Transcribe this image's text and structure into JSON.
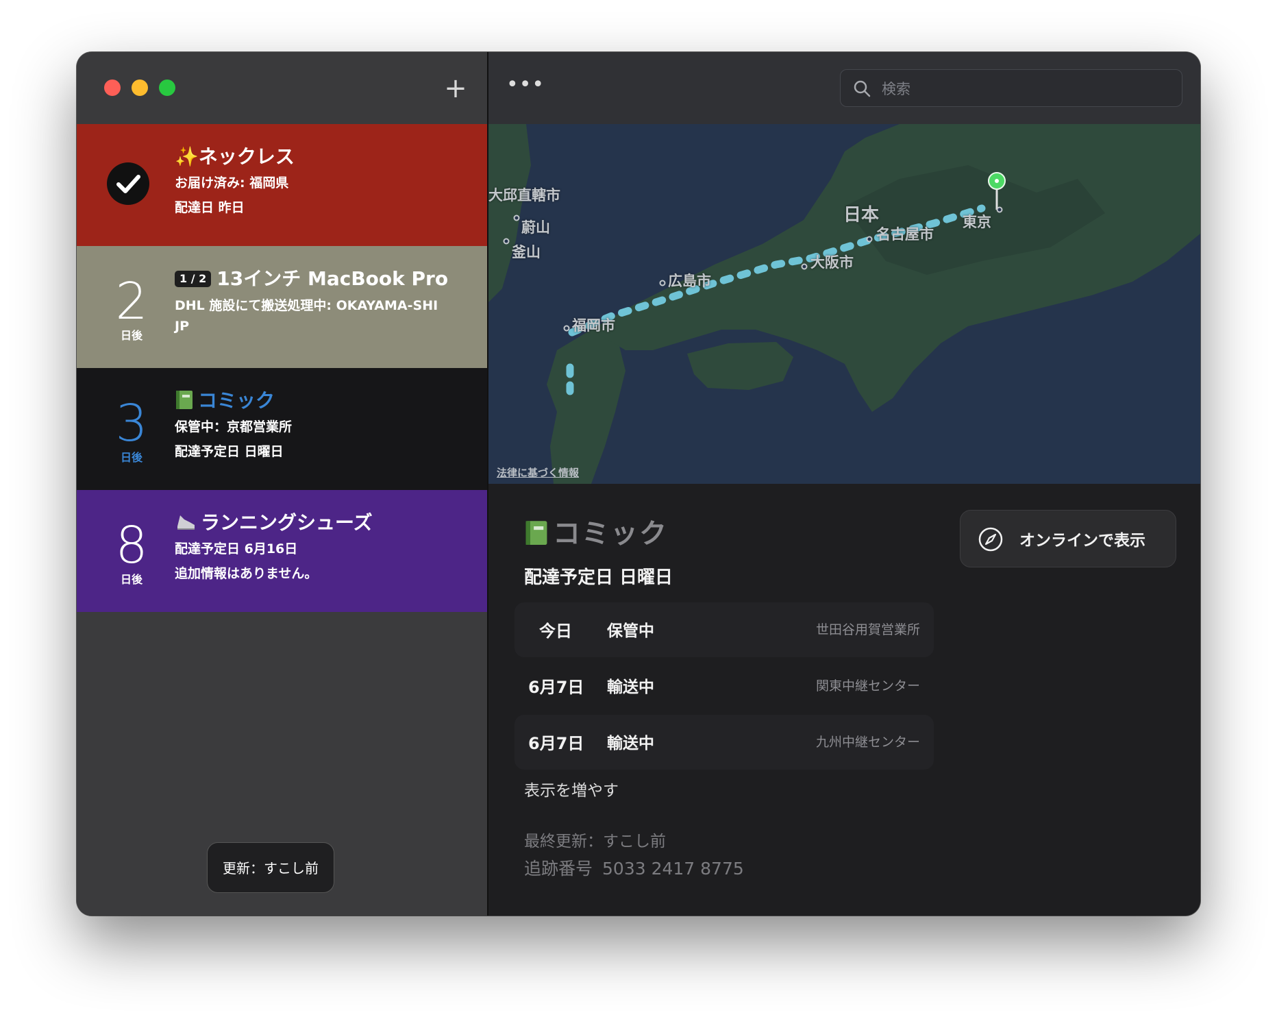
{
  "sidebar": {
    "add_label": "+",
    "items": [
      {
        "kind": "delivered",
        "title": "✨ネックレス",
        "line1": "お届け済み: 福岡県",
        "line2": "配達日 昨日",
        "bg": "#9d2419"
      },
      {
        "kind": "days",
        "days": "2",
        "unit": "日後",
        "part": "1 / 2",
        "title": "13インチ MacBook Pro",
        "line1": "DHL 施設にて搬送処理中: OKAYAMA-SHI",
        "line2": "JP",
        "bg": "#8d8c79"
      },
      {
        "kind": "days",
        "days": "3",
        "unit": "日後",
        "title": "コミック",
        "icon": "green-book-icon",
        "line1": "保管中：京都営業所",
        "line2": "配達予定日 日曜日",
        "bg": "#161618",
        "accent": "#3a86d6"
      },
      {
        "kind": "days",
        "days": "8",
        "unit": "日後",
        "title": "ランニングシューズ",
        "icon": "running-shoe-icon",
        "line1": "配達予定日 6月16日",
        "line2": "追加情報はありません。",
        "bg": "#4d2587"
      }
    ],
    "update_label": "更新：すこし前"
  },
  "toolbar": {
    "more_label": "•••",
    "search_placeholder": "検索"
  },
  "map": {
    "labels": {
      "daegu": "大邱直轄市",
      "ulsan": "蔚山",
      "busan": "釜山",
      "japan": "日本",
      "nagoya": "名古屋市",
      "tokyo": "東京",
      "osaka": "大阪市",
      "hiroshima": "広島市",
      "fukuoka": "福岡市"
    },
    "legal": "法律に基づく情報",
    "route_color": "#6fc3d6",
    "pin_color": "#4cd964"
  },
  "detail": {
    "title": "コミック",
    "subtitle": "配達予定日 日曜日",
    "online_button": "オンラインで表示",
    "events": [
      {
        "date": "今日",
        "status": "保管中",
        "location": "世田谷用賀営業所"
      },
      {
        "date": "6月7日",
        "status": "輸送中",
        "location": "関東中継センター"
      },
      {
        "date": "6月7日",
        "status": "輸送中",
        "location": "九州中継センター"
      }
    ],
    "more_link": "表示を増やす",
    "last_update": "最終更新：すこし前",
    "tracking_label": "追跡番号",
    "tracking_number": "5033 2417 8775"
  }
}
